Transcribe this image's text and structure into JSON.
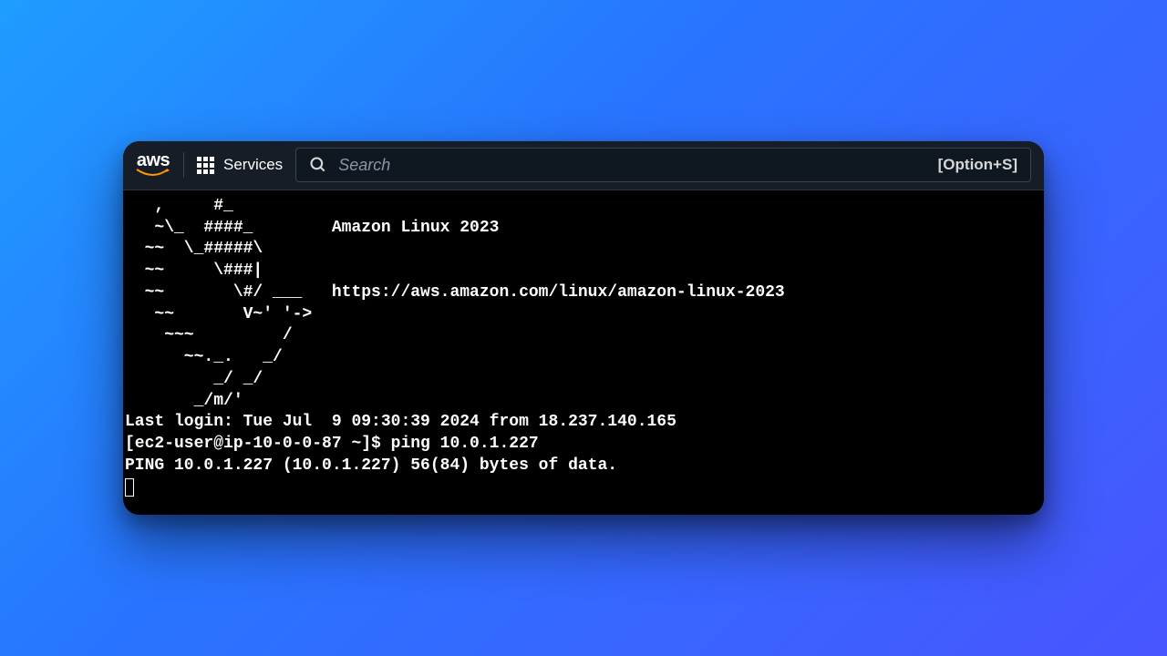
{
  "header": {
    "logo_text": "aws",
    "services_label": "Services",
    "search_placeholder": "Search",
    "shortcut": "[Option+S]"
  },
  "terminal": {
    "motd_line1": "   ,     #_",
    "motd_line2": "   ~\\_  ####_        Amazon Linux 2023",
    "motd_line3": "  ~~  \\_#####\\",
    "motd_line4": "  ~~     \\###|",
    "motd_line5": "  ~~       \\#/ ___   https://aws.amazon.com/linux/amazon-linux-2023",
    "motd_line6": "   ~~       V~' '->",
    "motd_line7": "    ~~~         /",
    "motd_line8": "      ~~._.   _/",
    "motd_line9": "         _/ _/",
    "motd_line10": "       _/m/'",
    "last_login": "Last login: Tue Jul  9 09:30:39 2024 from 18.237.140.165",
    "prompt_line": "[ec2-user@ip-10-0-0-87 ~]$ ping 10.0.1.227",
    "ping_output": "PING 10.0.1.227 (10.0.1.227) 56(84) bytes of data."
  }
}
